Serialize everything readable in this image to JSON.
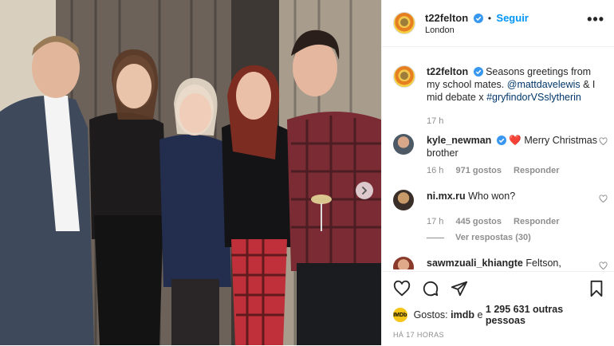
{
  "post": {
    "username": "t22felton",
    "separator": "•",
    "follow_label": "Seguir",
    "location": "London",
    "more_label": "•••"
  },
  "caption": {
    "username": "t22felton",
    "text_before": "Seasons greetings from my school mates.",
    "mention": "@mattdavelewis",
    "text_mid": "& I mid debate x",
    "hashtag": "#gryfindorVSslytherin",
    "time": "17 h"
  },
  "comments": [
    {
      "username": "kyle_newman",
      "verified": true,
      "emoji": "❤️",
      "text": "Merry Christmas brother",
      "time": "16 h",
      "likes": "971 gostos",
      "reply_label": "Responder"
    },
    {
      "username": "ni.mx.ru",
      "verified": false,
      "text": "Who won?",
      "time": "17 h",
      "likes": "445 gostos",
      "reply_label": "Responder",
      "view_replies": "Ver respostas (30)"
    },
    {
      "username": "sawmzuali_khiangte",
      "verified": false,
      "text": "Feltson,"
    }
  ],
  "likes": {
    "avatar_label": "IMDb",
    "prefix": "Gostos:",
    "first": "imdb",
    "connector": "e",
    "rest": "1 295 631 outras pessoas"
  },
  "timestamp": "HÁ 17 HORAS",
  "icons": [
    "heart-icon",
    "comment-icon",
    "share-icon",
    "bookmark-icon",
    "verified-icon",
    "chevron-right-icon"
  ],
  "colors": {
    "link": "#00376b",
    "follow": "#0095f6",
    "verified": "#3897f0",
    "muted": "#8e8e8e",
    "heart_red": "#ed4956"
  }
}
